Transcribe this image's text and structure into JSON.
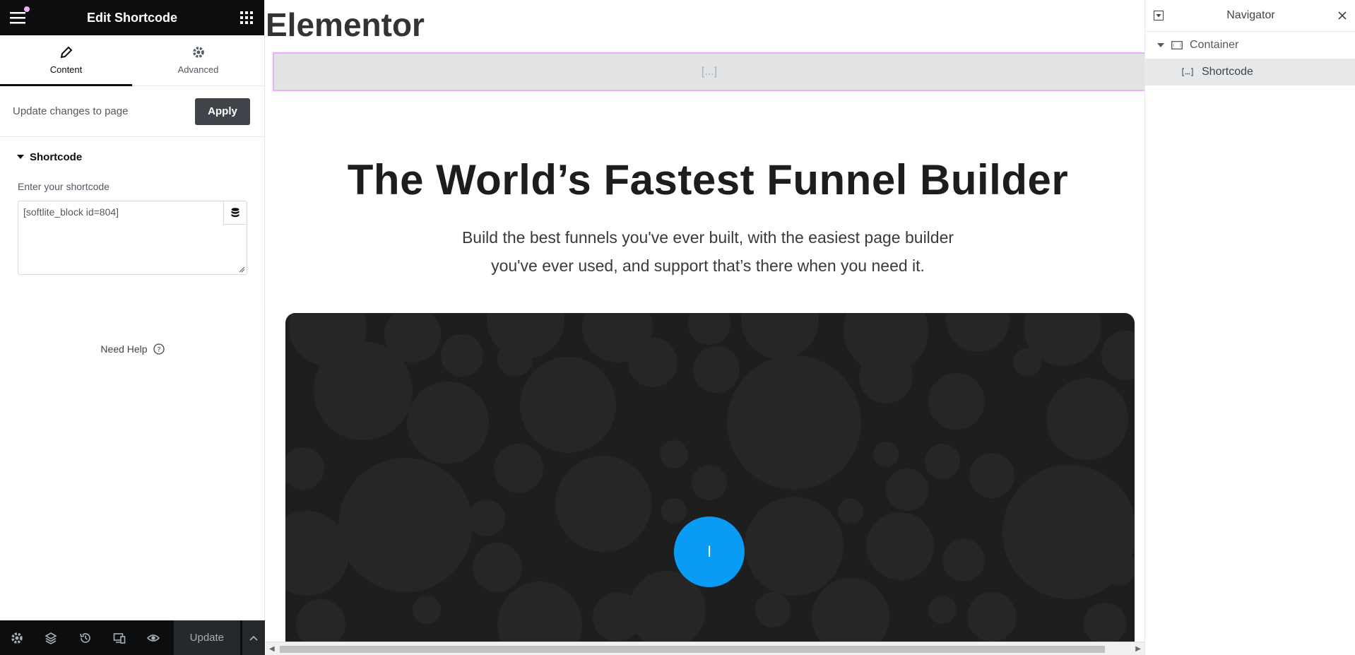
{
  "panel": {
    "title": "Edit Shortcode",
    "tabs": [
      {
        "label": "Content",
        "icon": "pencil-icon",
        "active": true
      },
      {
        "label": "Advanced",
        "icon": "gear-icon",
        "active": false
      }
    ],
    "apply_message": "Update changes to page",
    "apply_label": "Apply",
    "section_title": "Shortcode",
    "field_label": "Enter your shortcode",
    "field_value": "[softlite_block id=804]",
    "need_help": "Need Help",
    "footer": {
      "icons": [
        "settings-icon",
        "layers-icon",
        "history-icon",
        "responsive-icon",
        "preview-eye-icon"
      ],
      "update_label": "Update"
    }
  },
  "preview": {
    "site_title": "Elementor",
    "shortcode_placeholder": "[...]",
    "hero_title": "The World’s Fastest Funnel Builder",
    "hero_sub_line1": "Build the best funnels you've ever built, with the easiest page builder",
    "hero_sub_line2": "you've ever used, and support that’s there when you need it.",
    "play_glyph": "I",
    "accent_color": "#0a9cf5"
  },
  "navigator": {
    "title": "Navigator",
    "items": [
      {
        "label": "Container",
        "icon": "container-icon"
      },
      {
        "label": "Shortcode",
        "icon": "shortcode-icon"
      }
    ]
  },
  "colors": {
    "panel_dark": "#0c0d0e",
    "selection_outline": "#f0abfc",
    "video_bg": "#1e1e1e"
  }
}
